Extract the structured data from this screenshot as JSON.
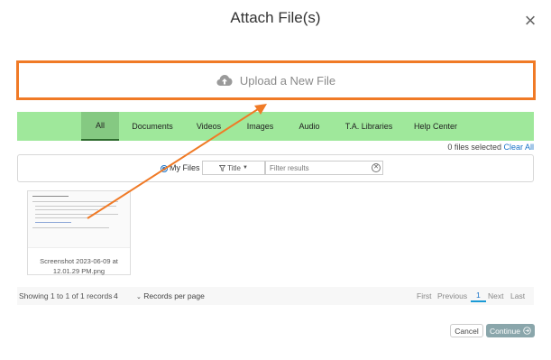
{
  "dialog": {
    "title": "Attach File(s)",
    "close_glyph": "×"
  },
  "upload": {
    "label": "Upload a New File",
    "icon": "cloud-upload-icon"
  },
  "tabs": [
    {
      "label": "All",
      "active": true
    },
    {
      "label": "Documents"
    },
    {
      "label": "Videos"
    },
    {
      "label": "Images"
    },
    {
      "label": "Audio"
    },
    {
      "label": "T.A. Libraries"
    },
    {
      "label": "Help Center"
    }
  ],
  "selection": {
    "count_text": "0 files selected",
    "clear_label": "Clear All"
  },
  "filter": {
    "scope_label": "My Files",
    "sort_label": "Title",
    "search_placeholder": "Filter results"
  },
  "files": [
    {
      "name": "Screenshot 2023-06-09 at 12.01.29 PM.png"
    }
  ],
  "pagination": {
    "summary": "Showing 1 to 1 of 1 records",
    "per_page_value": "4",
    "per_page_label": "Records per page",
    "first": "First",
    "previous": "Previous",
    "current": "1",
    "next": "Next",
    "last": "Last"
  },
  "actions": {
    "cancel": "Cancel",
    "continue": "Continue"
  },
  "colors": {
    "annotation": "#f07a26",
    "tab_bar": "#9fe89b",
    "link": "#1a73c8"
  }
}
